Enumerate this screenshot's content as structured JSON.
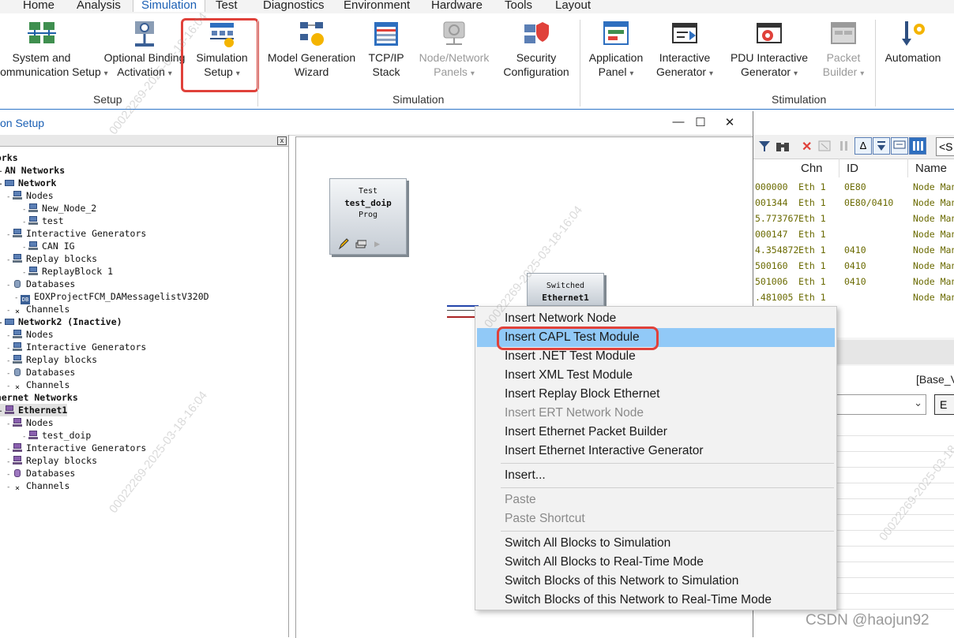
{
  "ribbon": {
    "tabs": [
      "Home",
      "Analysis",
      "Simulation",
      "Test",
      "Diagnostics",
      "Environment",
      "Hardware",
      "Tools",
      "Layout"
    ],
    "active_tab": "Simulation",
    "buttons": {
      "system_setup_1": "System and",
      "system_setup_2": "Communication Setup",
      "optional_binding_1": "Optional Binding",
      "optional_binding_2": "Activation",
      "simulation_setup_1": "Simulation",
      "simulation_setup_2": "Setup",
      "model_gen_1": "Model Generation",
      "model_gen_2": "Wizard",
      "tcpip_1": "TCP/IP",
      "tcpip_2": "Stack",
      "node_panels_1": "Node/Network",
      "node_panels_2": "Panels",
      "security_1": "Security",
      "security_2": "Configuration",
      "app_panel_1": "Application",
      "app_panel_2": "Panel",
      "interactive_gen_1": "Interactive",
      "interactive_gen_2": "Generator",
      "pdu_gen_1": "PDU Interactive",
      "pdu_gen_2": "Generator",
      "packet_builder_1": "Packet",
      "packet_builder_2": "Builder",
      "automation": "Automation"
    },
    "groups": {
      "setup": "Setup",
      "simulation": "Simulation",
      "stimulation": "Stimulation"
    },
    "dropdown_glyph": "▾"
  },
  "window": {
    "title": "on Setup",
    "minimize": "—",
    "maximize": "☐",
    "close": "✕",
    "pane_close": "x"
  },
  "tree": [
    {
      "text": "works",
      "indent": 0,
      "bold": true,
      "icon": ""
    },
    {
      "text": "AN Networks",
      "indent": 1,
      "bold": true,
      "icon": ""
    },
    {
      "text": "Network",
      "indent": 1,
      "bold": true,
      "icon": "netw"
    },
    {
      "text": "Nodes",
      "indent": 2,
      "bold": false,
      "icon": "pc"
    },
    {
      "text": "New_Node_2",
      "indent": 4,
      "bold": false,
      "icon": "pc"
    },
    {
      "text": "test",
      "indent": 4,
      "bold": false,
      "icon": "pc"
    },
    {
      "text": "Interactive Generators",
      "indent": 2,
      "bold": false,
      "icon": "pc"
    },
    {
      "text": "CAN IG",
      "indent": 4,
      "bold": false,
      "icon": "pc"
    },
    {
      "text": "Replay blocks",
      "indent": 2,
      "bold": false,
      "icon": "pc"
    },
    {
      "text": "ReplayBlock 1",
      "indent": 4,
      "bold": false,
      "icon": "pc"
    },
    {
      "text": "Databases",
      "indent": 2,
      "bold": false,
      "icon": "db"
    },
    {
      "text": "EOXProjectFCM_DAMessagelistV320D",
      "indent": 3,
      "bold": false,
      "icon": "dbc"
    },
    {
      "text": "Channels",
      "indent": 2,
      "bold": false,
      "icon": "x"
    },
    {
      "text": "Network2 (Inactive)",
      "indent": 1,
      "bold": true,
      "icon": "netw"
    },
    {
      "text": "Nodes",
      "indent": 2,
      "bold": false,
      "icon": "pc"
    },
    {
      "text": "Interactive Generators",
      "indent": 2,
      "bold": false,
      "icon": "pc"
    },
    {
      "text": "Replay blocks",
      "indent": 2,
      "bold": false,
      "icon": "pc"
    },
    {
      "text": "Databases",
      "indent": 2,
      "bold": false,
      "icon": "db"
    },
    {
      "text": "Channels",
      "indent": 2,
      "bold": false,
      "icon": "x"
    },
    {
      "text": "thernet Networks",
      "indent": 0,
      "bold": true,
      "icon": ""
    },
    {
      "text": "Ethernet1",
      "indent": 1,
      "bold": true,
      "icon": "eth",
      "selected": true
    },
    {
      "text": "Nodes",
      "indent": 2,
      "bold": false,
      "icon": "eth"
    },
    {
      "text": "test_doip",
      "indent": 4,
      "bold": false,
      "icon": "eth"
    },
    {
      "text": "Interactive Generators",
      "indent": 2,
      "bold": false,
      "icon": "eth"
    },
    {
      "text": "Replay blocks",
      "indent": 2,
      "bold": false,
      "icon": "eth"
    },
    {
      "text": "Databases",
      "indent": 2,
      "bold": false,
      "icon": "dbp"
    },
    {
      "text": "Channels",
      "indent": 2,
      "bold": false,
      "icon": "x"
    }
  ],
  "canvas": {
    "test_block": {
      "line1": "Test",
      "line2": "test_doip",
      "line3": "Prog"
    },
    "switch_block": {
      "line1": "Switched",
      "line2": "Ethernet1"
    }
  },
  "trace": {
    "search_placeholder": "<S",
    "columns": [
      "Chn",
      "ID",
      "Name"
    ],
    "rows": [
      [
        "000000",
        "Eth 1",
        "0E80",
        "Node Man"
      ],
      [
        "001344",
        "Eth 1",
        "0E80/0410",
        "Node Man"
      ],
      [
        "5.773767",
        "Eth 1",
        "",
        "Node Man"
      ],
      [
        "000147",
        "Eth 1",
        "",
        "Node Man"
      ],
      [
        "4.354872",
        "Eth 1",
        "0410",
        "Node Man"
      ],
      [
        "500160",
        "Eth 1",
        "0410",
        "Node Man"
      ],
      [
        "501006",
        "Eth 1",
        "0410",
        "Node Man"
      ],
      [
        ".481005",
        "Eth 1",
        "",
        "Node Man"
      ]
    ],
    "lower_label": "[Base_V",
    "lower_button": "E"
  },
  "context_menu": {
    "items": [
      {
        "label": "Insert Network Node",
        "disabled": false
      },
      {
        "label": "Insert CAPL Test Module",
        "disabled": false,
        "hover": true
      },
      {
        "label": "Insert .NET Test Module",
        "disabled": false
      },
      {
        "label": "Insert XML Test Module",
        "disabled": false
      },
      {
        "label": "Insert Replay Block Ethernet",
        "disabled": false
      },
      {
        "label": "Insert ERT Network Node",
        "disabled": true
      },
      {
        "label": "Insert Ethernet Packet Builder",
        "disabled": false
      },
      {
        "label": "Insert Ethernet Interactive Generator",
        "disabled": false
      },
      {
        "separator": true
      },
      {
        "label": "Insert...",
        "disabled": false
      },
      {
        "separator": true
      },
      {
        "label": "Paste",
        "disabled": true
      },
      {
        "label": "Paste Shortcut",
        "disabled": true
      },
      {
        "separator": true
      },
      {
        "label": "Switch All Blocks to Simulation",
        "disabled": false
      },
      {
        "label": "Switch All Blocks to Real-Time Mode",
        "disabled": false
      },
      {
        "label": "Switch Blocks of this Network to Simulation",
        "disabled": false
      },
      {
        "label": "Switch Blocks of this Network to Real-Time Mode",
        "disabled": false
      }
    ]
  },
  "watermark": "00022269-2025-03-18-16:04",
  "csdn_credit": "CSDN @haojun92",
  "colors": {
    "accent": "#1a5fb4",
    "highlight_red": "#e0413a",
    "menu_hover": "#91c9f7",
    "trace_text": "#6a6a00"
  }
}
